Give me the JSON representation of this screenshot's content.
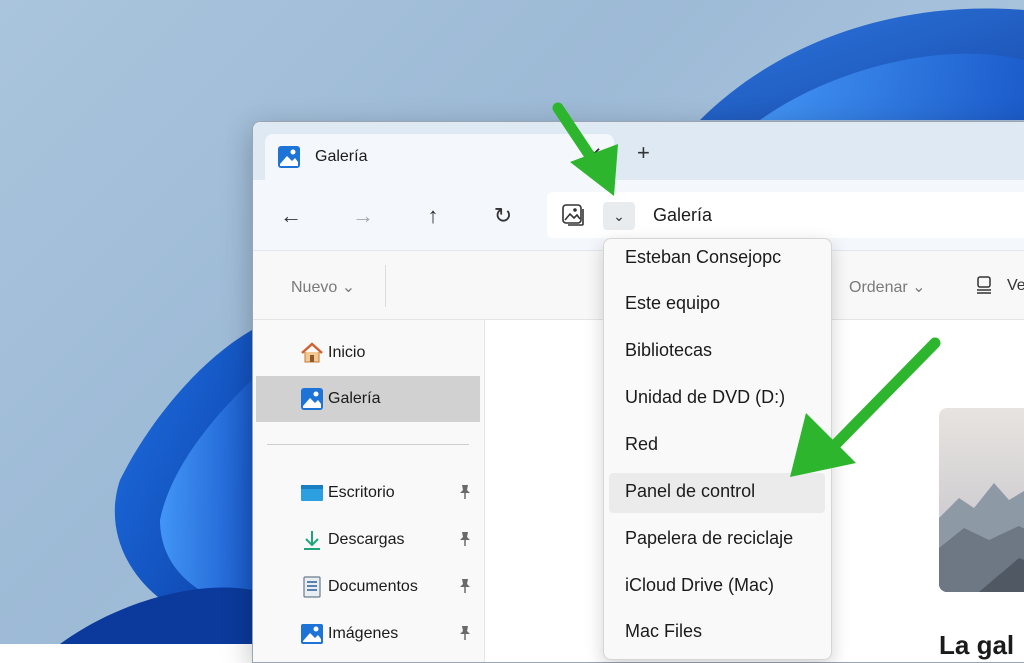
{
  "window": {
    "tab": {
      "title": "Galería",
      "close": "✕"
    },
    "new_tab": "+"
  },
  "nav": {
    "back": "←",
    "forward": "→",
    "up": "↑",
    "refresh": "↻"
  },
  "address": {
    "icon": "gallery-icon",
    "chevron": "⌄",
    "text": "Galería"
  },
  "command_bar": {
    "nuevo": "Nuevo ⌄",
    "ordenar": "Ordenar ⌄",
    "ver": "Ve"
  },
  "sidebar": {
    "items": [
      {
        "label": "Inicio",
        "icon": "home-icon"
      },
      {
        "label": "Galería",
        "icon": "gallery-icon",
        "selected": true
      },
      {
        "label": "Escritorio",
        "icon": "desktop-icon",
        "pinned": true
      },
      {
        "label": "Descargas",
        "icon": "download-icon",
        "pinned": true
      },
      {
        "label": "Documentos",
        "icon": "document-icon",
        "pinned": true
      },
      {
        "label": "Imágenes",
        "icon": "pictures-icon",
        "pinned": true
      }
    ]
  },
  "content": {
    "heading": "La gal"
  },
  "dropdown": {
    "items": [
      "Esteban Consejopc",
      "Este equipo",
      "Bibliotecas",
      "Unidad de DVD (D:)",
      "Red",
      "Panel de control",
      "Papelera de reciclaje",
      "iCloud Drive (Mac)",
      "Mac Files"
    ],
    "highlighted": "Panel de control"
  },
  "colors": {
    "accent": "#0078d4",
    "arrow": "#2db52d",
    "selected_bg": "#d1d1d1"
  }
}
